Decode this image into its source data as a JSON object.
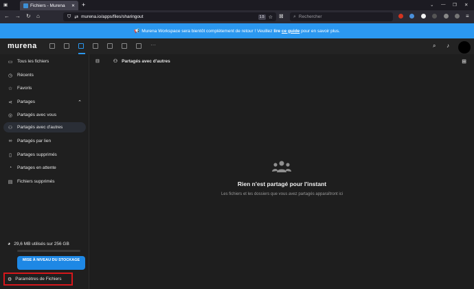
{
  "browser": {
    "tab_title": "Fichiers - Murena",
    "new_tab": "+",
    "url": "murena.io/apps/files/sharingout",
    "url_badge": "1.5",
    "search_placeholder": "Rechercher",
    "win_controls": [
      "⌄",
      "—",
      "❐",
      "✕"
    ]
  },
  "banner": {
    "text_before": "Murena Workspace sera bientôt complètement de retour ! Veuillez",
    "read": "lire",
    "link": "ce guide",
    "text_after": "pour en savoir plus."
  },
  "header": {
    "logo": "murena"
  },
  "sidebar": {
    "items": [
      {
        "icon": "folder-icon",
        "glyph": "▭",
        "label": "Tous les fichiers"
      },
      {
        "icon": "clock-icon",
        "glyph": "◷",
        "label": "Récents"
      },
      {
        "icon": "star-icon",
        "glyph": "☆",
        "label": "Favoris"
      },
      {
        "icon": "share-icon",
        "glyph": "⋖",
        "label": "Partages",
        "toggle": "⌃"
      },
      {
        "icon": "person-icon",
        "glyph": "◎",
        "label": "Partagés avec vous"
      },
      {
        "icon": "people-icon",
        "glyph": "⚇",
        "label": "Partagés avec d'autres"
      },
      {
        "icon": "link-icon",
        "glyph": "∞",
        "label": "Partagés par lien"
      },
      {
        "icon": "trash-icon",
        "glyph": "▯",
        "label": "Partages supprimés"
      },
      {
        "icon": "pending-icon",
        "glyph": "◔",
        "label": "Partages en attente"
      },
      {
        "icon": "deleted-files-icon",
        "glyph": "▤",
        "label": "Fichiers supprimés"
      }
    ],
    "storage_text": "29,6 MB utilisés sur 256 GB",
    "upgrade_button": "MISE À NIVEAU DU STOCKAGE",
    "settings_label": "Paramètres de Fichiers"
  },
  "main": {
    "breadcrumb": "Partagés avec d'autres",
    "empty_title": "Rien n'est partagé pour l'instant",
    "empty_desc": "Les fichiers et les dossiers que vous avez partagés apparaîtront ici"
  },
  "colors": {
    "accent": "#2b98f0",
    "highlight_border": "#d8171b"
  }
}
